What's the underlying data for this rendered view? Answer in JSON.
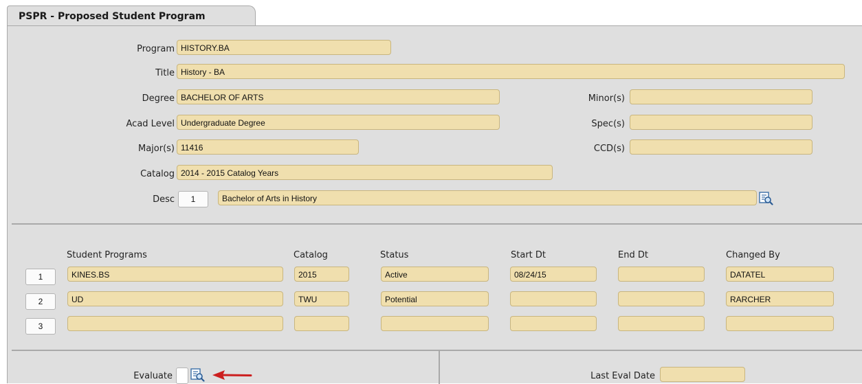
{
  "tab": {
    "title": "PSPR - Proposed Student Program"
  },
  "form": {
    "program": {
      "label": "Program",
      "value": "HISTORY.BA"
    },
    "title": {
      "label": "Title",
      "value": "History - BA"
    },
    "degree": {
      "label": "Degree",
      "value": "BACHELOR OF ARTS"
    },
    "acad_level": {
      "label": "Acad Level",
      "value": "Undergraduate Degree"
    },
    "majors": {
      "label": "Major(s)",
      "value": "11416"
    },
    "catalog": {
      "label": "Catalog",
      "value": "2014 - 2015 Catalog Years"
    },
    "desc": {
      "label": "Desc",
      "index": "1",
      "value": "Bachelor of Arts in History"
    },
    "minors": {
      "label": "Minor(s)",
      "value": ""
    },
    "specs": {
      "label": "Spec(s)",
      "value": ""
    },
    "ccds": {
      "label": "CCD(s)",
      "value": ""
    }
  },
  "table": {
    "headers": [
      "Student Programs",
      "Catalog",
      "Status",
      "Start Dt",
      "End Dt",
      "Changed By"
    ],
    "rows": [
      {
        "index": "1",
        "program": "KINES.BS",
        "catalog": "2015",
        "status": "Active",
        "start_dt": "08/24/15",
        "end_dt": "",
        "changed_by": "DATATEL"
      },
      {
        "index": "2",
        "program": "UD",
        "catalog": "TWU",
        "status": "Potential",
        "start_dt": "",
        "end_dt": "",
        "changed_by": "RARCHER"
      },
      {
        "index": "3",
        "program": "",
        "catalog": "",
        "status": "",
        "start_dt": "",
        "end_dt": "",
        "changed_by": ""
      }
    ]
  },
  "bottom": {
    "evaluate_label": "Evaluate",
    "last_eval_label": "Last Eval Date",
    "last_eval_value": ""
  },
  "icons": {
    "detail": "detail-lookup-icon",
    "arrow": "red-arrow-icon"
  },
  "colors": {
    "field_bg": "#f0dfae",
    "panel_bg": "#dfdfdf",
    "arrow": "#cc1f1f"
  }
}
